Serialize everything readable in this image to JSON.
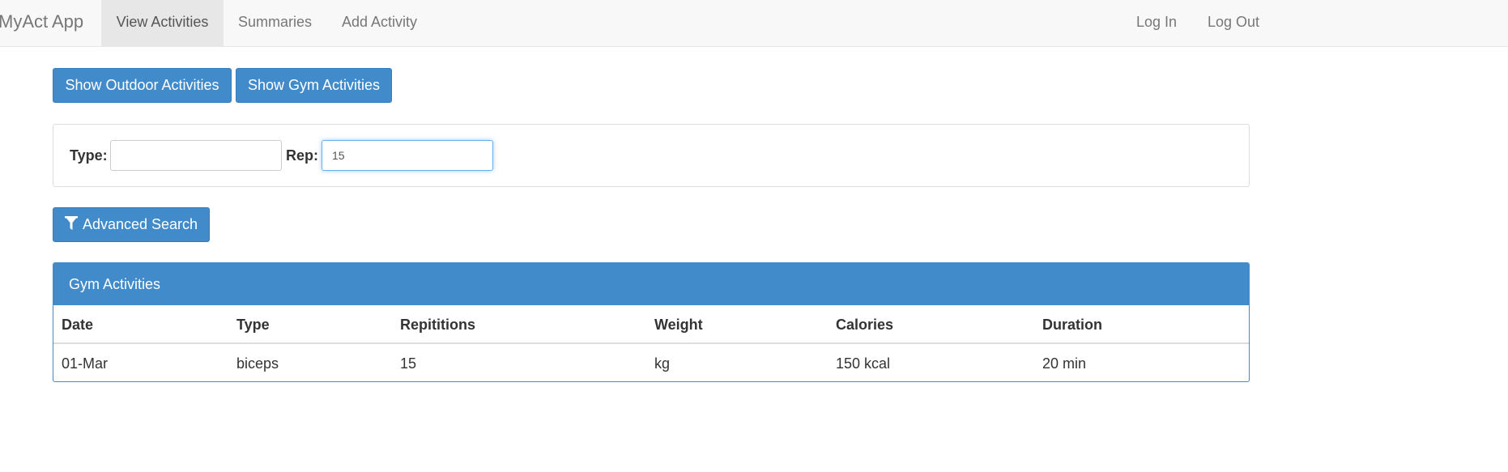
{
  "navbar": {
    "brand": "MyAct App",
    "items": [
      {
        "label": "View Activities",
        "active": true
      },
      {
        "label": "Summaries"
      },
      {
        "label": "Add Activity"
      }
    ],
    "right_items": [
      {
        "label": "Log In"
      },
      {
        "label": "Log Out"
      }
    ]
  },
  "toolbar": {
    "outdoor_label": "Show Outdoor Activities",
    "gym_label": "Show Gym Activities"
  },
  "search": {
    "type_label": "Type:",
    "type_value": "",
    "rep_label": "Rep:",
    "rep_value": "15",
    "advanced_label": "Advanced Search",
    "advanced_icon": "filter-icon"
  },
  "panel": {
    "title": "Gym Activities",
    "columns": [
      "Date",
      "Type",
      "Repititions",
      "Weight",
      "Calories",
      "Duration"
    ],
    "rows": [
      [
        "01-Mar",
        "biceps",
        "15",
        "kg",
        "150 kcal",
        "20 min"
      ]
    ]
  },
  "colors": {
    "primary": "#428bca",
    "navbar_bg": "#f8f8f8",
    "nav_active_bg": "#e7e7e7",
    "focus_border": "#66afe9"
  }
}
